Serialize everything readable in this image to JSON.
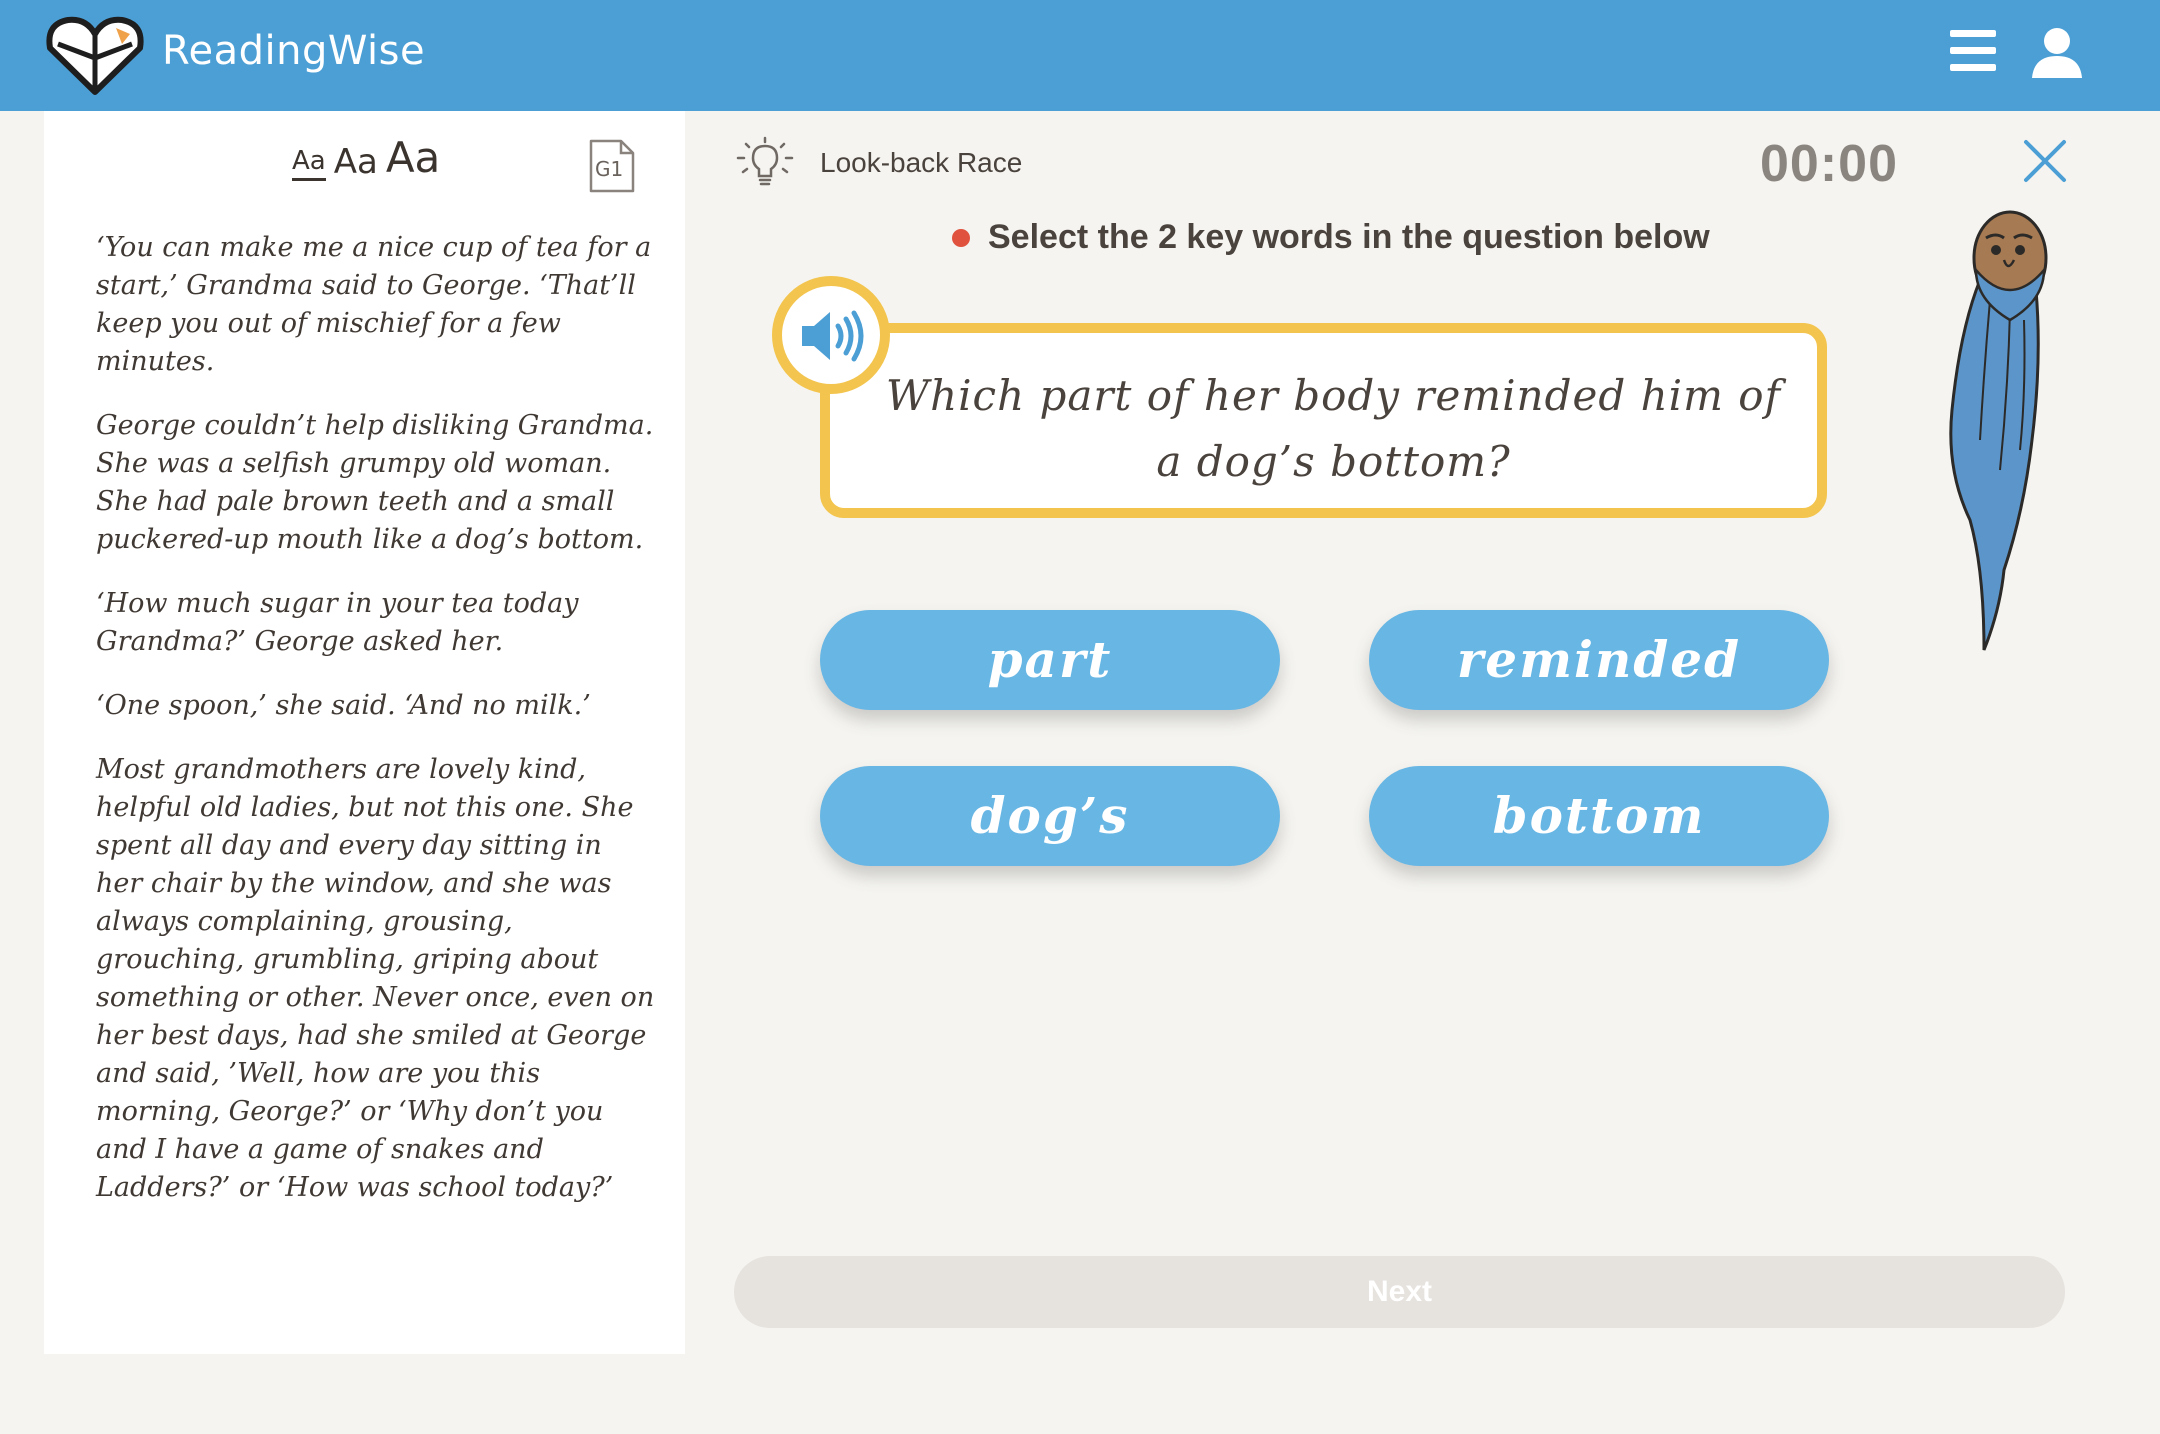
{
  "app": {
    "brand": "ReadingWise"
  },
  "reader": {
    "font_sizes": [
      "Aa",
      "Aa",
      "Aa"
    ],
    "level_badge": "G1",
    "paragraphs": [
      "‘You can make me a nice cup of tea for a start,’ Grandma said to George. ‘That’ll keep you out of mischief for a few minutes.",
      "George couldn’t help disliking Grandma. She was a selfish grumpy old woman. She had pale brown teeth and a small puckered-up mouth like a dog’s bottom.",
      "‘How much sugar in your tea today Grandma?’ George asked her.",
      "‘One spoon,’ she said. ‘And no milk.’",
      "Most grandmothers are lovely kind, helpful old ladies, but not this one. She spent all day and every day sitting in her chair by the window, and she was always complaining, grousing, grouching, grumbling, griping about something or other. Never once, even on her best days, had she smiled at George and said, ’Well, how are you this morning, George?’ or ‘Why don’t you and I have a game of snakes and Ladders?’ or ‘How was school today?’"
    ]
  },
  "activity": {
    "title": "Look-back Race",
    "timer": "00:00",
    "instruction": "Select the 2 key words in the question below",
    "question": "Which part of her body reminded him of a dog’s bottom?",
    "answers": [
      "part",
      "reminded",
      "dog’s",
      "bottom"
    ],
    "next_label": "Next"
  },
  "colors": {
    "header": "#4b9fd5",
    "answer_button": "#68b6e4",
    "card_border": "#f3c54e",
    "indicator_dot": "#e0523e",
    "next_disabled": "#e6e2de"
  }
}
